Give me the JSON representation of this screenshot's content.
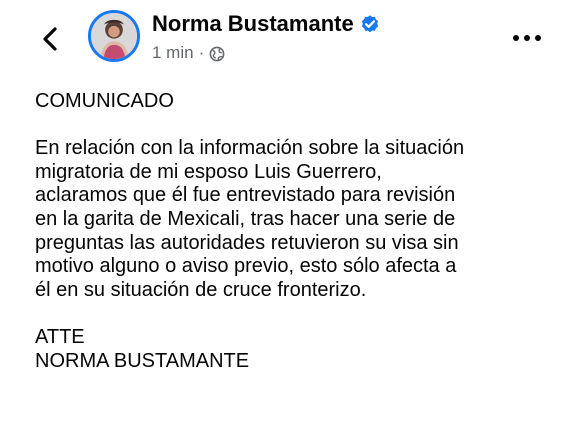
{
  "header": {
    "author_name": "Norma Bustamante",
    "timestamp": "1 min",
    "separator": "·",
    "visibility_icon": "globe-icon",
    "verified_icon": "verified-badge-icon",
    "back_icon": "chevron-left-icon",
    "more_icon": "more-options-icon"
  },
  "post": {
    "heading": "COMUNICADO",
    "body_lines": [
      "En relación con la información sobre la situación",
      "migratoria de mi esposo Luis Guerrero,",
      "aclaramos que él fue entrevistado para revisión",
      "en la garita de Mexicali, tras hacer una serie de",
      "preguntas las autoridades retuvieron su visa sin",
      "motivo alguno o aviso previo, esto sólo afecta a",
      "él en su situación de cruce fronterizo."
    ],
    "signoff": "ATTE",
    "signature": "NORMA BUSTAMANTE"
  },
  "colors": {
    "text": "#050505",
    "muted": "#65676b",
    "verified": "#1877f2",
    "background": "#ffffff"
  }
}
